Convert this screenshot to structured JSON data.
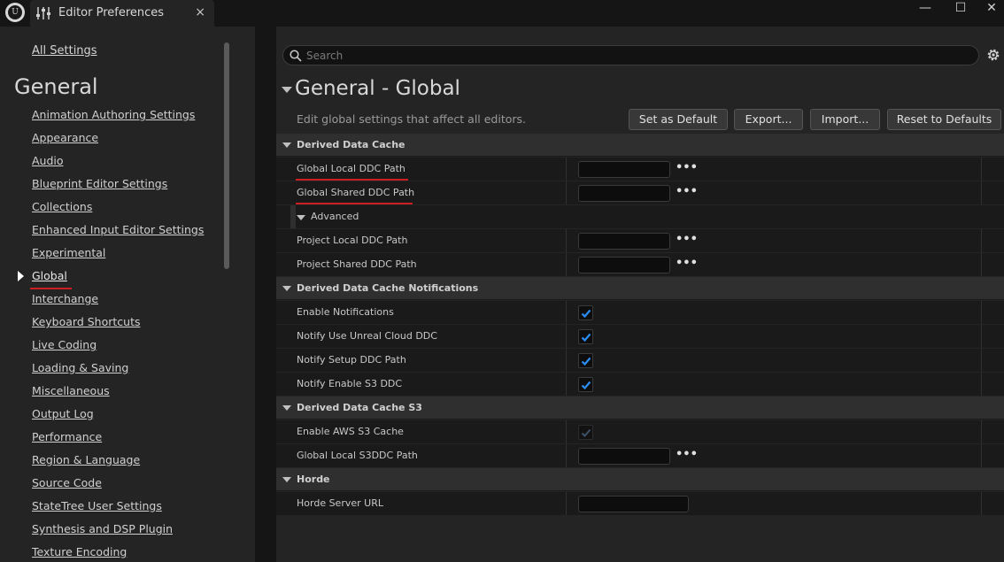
{
  "window": {
    "tab_title": "Editor Preferences",
    "tab_close": "×",
    "minimize": "—",
    "maximize": "☐",
    "close": "✕"
  },
  "left": {
    "all_settings": "All Settings",
    "category_title": "General",
    "items": [
      {
        "label": "Animation Authoring Settings"
      },
      {
        "label": "Appearance"
      },
      {
        "label": "Audio"
      },
      {
        "label": "Blueprint Editor Settings"
      },
      {
        "label": "Collections"
      },
      {
        "label": "Enhanced Input Editor Settings"
      },
      {
        "label": "Experimental"
      },
      {
        "label": "Global"
      },
      {
        "label": "Interchange"
      },
      {
        "label": "Keyboard Shortcuts"
      },
      {
        "label": "Live Coding"
      },
      {
        "label": "Loading & Saving"
      },
      {
        "label": "Miscellaneous"
      },
      {
        "label": "Output Log"
      },
      {
        "label": "Performance"
      },
      {
        "label": "Region & Language"
      },
      {
        "label": "Source Code"
      },
      {
        "label": "StateTree User Settings"
      },
      {
        "label": "Synthesis and DSP Plugin"
      },
      {
        "label": "Texture Encoding"
      }
    ],
    "active_item": "Global"
  },
  "right": {
    "search_placeholder": "Search",
    "section_title": "General - Global",
    "section_desc": "Edit global settings that affect all editors.",
    "buttons": {
      "set_default": "Set as Default",
      "export": "Export...",
      "import": "Import...",
      "reset": "Reset to Defaults"
    },
    "categories": {
      "ddc": "Derived Data Cache",
      "ddc_notifications": "Derived Data Cache Notifications",
      "ddc_s3": "Derived Data Cache S3",
      "horde": "Horde"
    },
    "properties": {
      "global_local_ddc": "Global Local DDC Path",
      "global_shared_ddc": "Global Shared DDC Path",
      "advanced": "Advanced",
      "project_local_ddc": "Project Local DDC Path",
      "project_shared_ddc": "Project Shared DDC Path",
      "enable_notifications": "Enable Notifications",
      "notify_unreal_cloud": "Notify Use Unreal Cloud DDC",
      "notify_setup_ddc": "Notify Setup DDC Path",
      "notify_s3": "Notify Enable S3 DDC",
      "enable_aws_s3": "Enable AWS S3 Cache",
      "global_local_s3ddc": "Global Local S3DDC Path",
      "horde_server_url": "Horde Server URL"
    },
    "browse_label": "•••",
    "checkbox_states": {
      "enable_notifications": true,
      "notify_unreal_cloud": true,
      "notify_setup_ddc": true,
      "notify_s3": true,
      "enable_aws_s3": true
    }
  },
  "colors": {
    "accent_check": "#2a8ef5",
    "annotation_red": "#cc1f1f",
    "panel_bg": "#242424",
    "row_bg": "#1a1a1a"
  }
}
